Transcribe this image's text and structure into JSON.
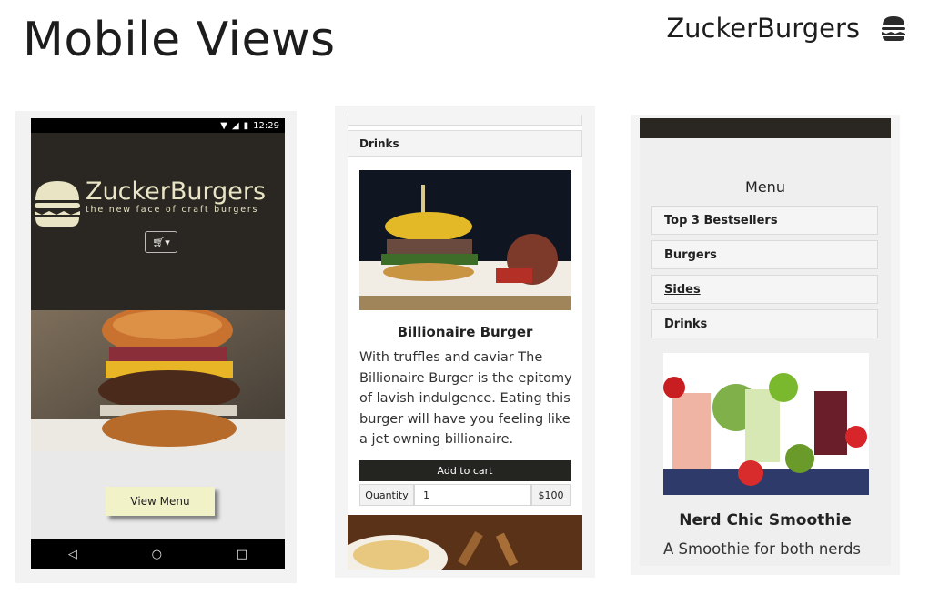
{
  "header": {
    "title": "Mobile Views",
    "brand": "ZuckerBurgers"
  },
  "view1": {
    "status_time": "12:29",
    "logo_title": "ZuckerBurgers",
    "logo_tagline": "the new face of craft burgers",
    "cart_icon": "cart-icon",
    "view_menu_label": "View Menu",
    "nav": {
      "back": "◁",
      "home": "○",
      "recent": "□"
    },
    "colors": {
      "hero_bg": "#2a2722",
      "logo": "#e8e4c4",
      "button_bg": "#f1f2c8"
    }
  },
  "view2": {
    "category": "Drinks",
    "product": {
      "name": "Billionaire Burger",
      "description": "With truffles and caviar The Billionaire Burger is the epitomy of lavish indulgence. Eating this burger will have you feeling like a jet owning billionaire.",
      "add_to_cart": "Add to cart",
      "quantity_label": "Quantity",
      "quantity_value": "1",
      "price": "$100"
    }
  },
  "view3": {
    "menu_heading": "Menu",
    "menu_items": [
      {
        "label": "Top 3 Bestsellers"
      },
      {
        "label": "Burgers"
      },
      {
        "label": "Sides"
      },
      {
        "label": "Drinks"
      }
    ],
    "item": {
      "name": "Nerd Chic Smoothie",
      "description": "A Smoothie for both nerds"
    }
  }
}
